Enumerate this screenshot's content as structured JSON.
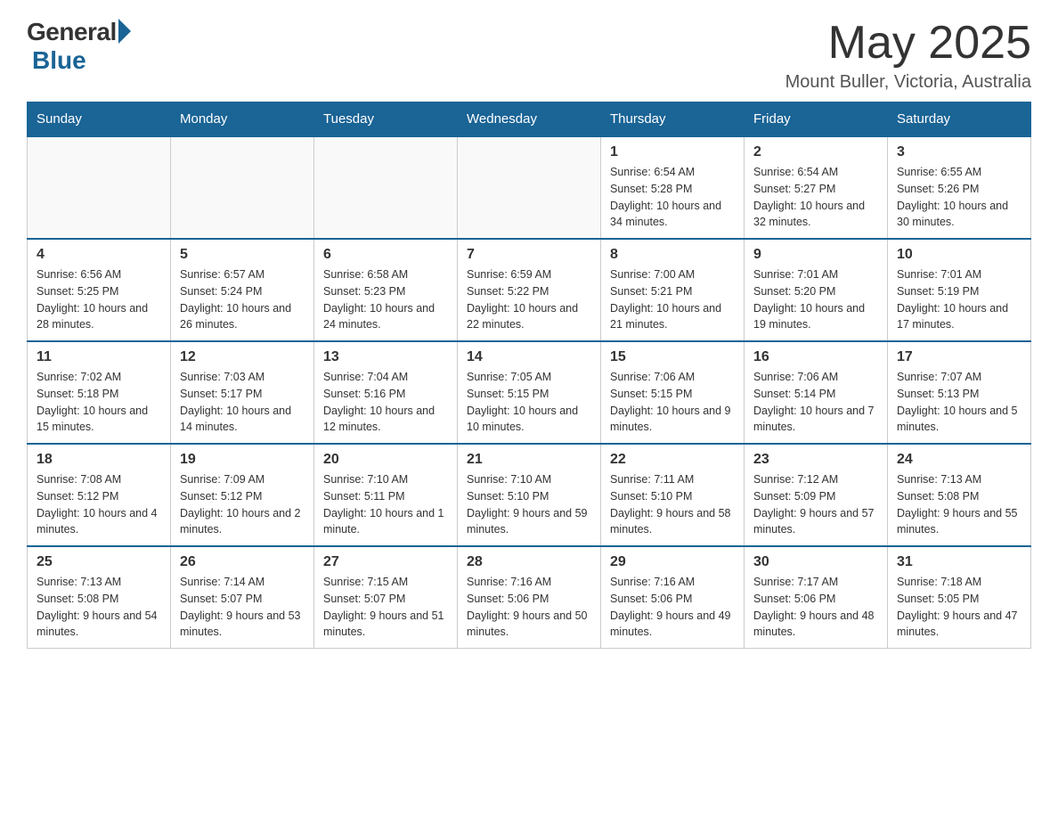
{
  "header": {
    "logo_general": "General",
    "logo_blue": "Blue",
    "month_year": "May 2025",
    "location": "Mount Buller, Victoria, Australia"
  },
  "days_of_week": [
    "Sunday",
    "Monday",
    "Tuesday",
    "Wednesday",
    "Thursday",
    "Friday",
    "Saturday"
  ],
  "weeks": [
    [
      {
        "day": "",
        "info": ""
      },
      {
        "day": "",
        "info": ""
      },
      {
        "day": "",
        "info": ""
      },
      {
        "day": "",
        "info": ""
      },
      {
        "day": "1",
        "info": "Sunrise: 6:54 AM\nSunset: 5:28 PM\nDaylight: 10 hours and 34 minutes."
      },
      {
        "day": "2",
        "info": "Sunrise: 6:54 AM\nSunset: 5:27 PM\nDaylight: 10 hours and 32 minutes."
      },
      {
        "day": "3",
        "info": "Sunrise: 6:55 AM\nSunset: 5:26 PM\nDaylight: 10 hours and 30 minutes."
      }
    ],
    [
      {
        "day": "4",
        "info": "Sunrise: 6:56 AM\nSunset: 5:25 PM\nDaylight: 10 hours and 28 minutes."
      },
      {
        "day": "5",
        "info": "Sunrise: 6:57 AM\nSunset: 5:24 PM\nDaylight: 10 hours and 26 minutes."
      },
      {
        "day": "6",
        "info": "Sunrise: 6:58 AM\nSunset: 5:23 PM\nDaylight: 10 hours and 24 minutes."
      },
      {
        "day": "7",
        "info": "Sunrise: 6:59 AM\nSunset: 5:22 PM\nDaylight: 10 hours and 22 minutes."
      },
      {
        "day": "8",
        "info": "Sunrise: 7:00 AM\nSunset: 5:21 PM\nDaylight: 10 hours and 21 minutes."
      },
      {
        "day": "9",
        "info": "Sunrise: 7:01 AM\nSunset: 5:20 PM\nDaylight: 10 hours and 19 minutes."
      },
      {
        "day": "10",
        "info": "Sunrise: 7:01 AM\nSunset: 5:19 PM\nDaylight: 10 hours and 17 minutes."
      }
    ],
    [
      {
        "day": "11",
        "info": "Sunrise: 7:02 AM\nSunset: 5:18 PM\nDaylight: 10 hours and 15 minutes."
      },
      {
        "day": "12",
        "info": "Sunrise: 7:03 AM\nSunset: 5:17 PM\nDaylight: 10 hours and 14 minutes."
      },
      {
        "day": "13",
        "info": "Sunrise: 7:04 AM\nSunset: 5:16 PM\nDaylight: 10 hours and 12 minutes."
      },
      {
        "day": "14",
        "info": "Sunrise: 7:05 AM\nSunset: 5:15 PM\nDaylight: 10 hours and 10 minutes."
      },
      {
        "day": "15",
        "info": "Sunrise: 7:06 AM\nSunset: 5:15 PM\nDaylight: 10 hours and 9 minutes."
      },
      {
        "day": "16",
        "info": "Sunrise: 7:06 AM\nSunset: 5:14 PM\nDaylight: 10 hours and 7 minutes."
      },
      {
        "day": "17",
        "info": "Sunrise: 7:07 AM\nSunset: 5:13 PM\nDaylight: 10 hours and 5 minutes."
      }
    ],
    [
      {
        "day": "18",
        "info": "Sunrise: 7:08 AM\nSunset: 5:12 PM\nDaylight: 10 hours and 4 minutes."
      },
      {
        "day": "19",
        "info": "Sunrise: 7:09 AM\nSunset: 5:12 PM\nDaylight: 10 hours and 2 minutes."
      },
      {
        "day": "20",
        "info": "Sunrise: 7:10 AM\nSunset: 5:11 PM\nDaylight: 10 hours and 1 minute."
      },
      {
        "day": "21",
        "info": "Sunrise: 7:10 AM\nSunset: 5:10 PM\nDaylight: 9 hours and 59 minutes."
      },
      {
        "day": "22",
        "info": "Sunrise: 7:11 AM\nSunset: 5:10 PM\nDaylight: 9 hours and 58 minutes."
      },
      {
        "day": "23",
        "info": "Sunrise: 7:12 AM\nSunset: 5:09 PM\nDaylight: 9 hours and 57 minutes."
      },
      {
        "day": "24",
        "info": "Sunrise: 7:13 AM\nSunset: 5:08 PM\nDaylight: 9 hours and 55 minutes."
      }
    ],
    [
      {
        "day": "25",
        "info": "Sunrise: 7:13 AM\nSunset: 5:08 PM\nDaylight: 9 hours and 54 minutes."
      },
      {
        "day": "26",
        "info": "Sunrise: 7:14 AM\nSunset: 5:07 PM\nDaylight: 9 hours and 53 minutes."
      },
      {
        "day": "27",
        "info": "Sunrise: 7:15 AM\nSunset: 5:07 PM\nDaylight: 9 hours and 51 minutes."
      },
      {
        "day": "28",
        "info": "Sunrise: 7:16 AM\nSunset: 5:06 PM\nDaylight: 9 hours and 50 minutes."
      },
      {
        "day": "29",
        "info": "Sunrise: 7:16 AM\nSunset: 5:06 PM\nDaylight: 9 hours and 49 minutes."
      },
      {
        "day": "30",
        "info": "Sunrise: 7:17 AM\nSunset: 5:06 PM\nDaylight: 9 hours and 48 minutes."
      },
      {
        "day": "31",
        "info": "Sunrise: 7:18 AM\nSunset: 5:05 PM\nDaylight: 9 hours and 47 minutes."
      }
    ]
  ]
}
